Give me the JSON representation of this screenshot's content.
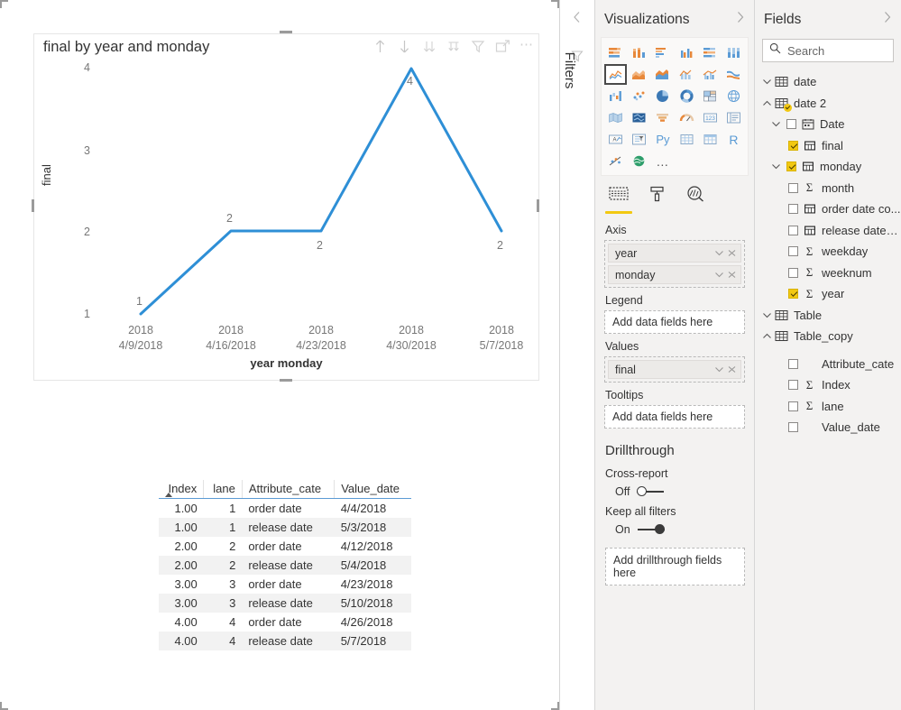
{
  "chart_data": {
    "type": "line",
    "title": "final by year and monday",
    "xlabel": "year monday",
    "ylabel": "final",
    "categories": [
      "2018\n4/9/2018",
      "2018\n4/16/2018",
      "2018\n4/23/2018",
      "2018\n4/30/2018",
      "2018\n5/7/2018"
    ],
    "category_lines": [
      [
        "2018",
        "4/9/2018"
      ],
      [
        "2018",
        "4/16/2018"
      ],
      [
        "2018",
        "4/23/2018"
      ],
      [
        "2018",
        "4/30/2018"
      ],
      [
        "2018",
        "5/7/2018"
      ]
    ],
    "values": [
      1,
      2,
      2,
      4,
      2
    ],
    "data_labels": [
      "1",
      "2",
      "2",
      "4",
      "2"
    ],
    "yticks": [
      "1",
      "2",
      "3",
      "4"
    ],
    "ylim": [
      1,
      4
    ],
    "grid": false,
    "legend": null,
    "series_color": "#2E8FD6",
    "line_width": 3
  },
  "visual": {
    "title": "final by year and monday",
    "toolbar": [
      {
        "name": "drill-up-icon",
        "label": "Drill up"
      },
      {
        "name": "drill-down-icon",
        "label": "Drill down"
      },
      {
        "name": "expand-all-icon",
        "label": "Expand all down one level"
      },
      {
        "name": "go-to-next-level-icon",
        "label": "Go to the next level"
      },
      {
        "name": "filter-icon",
        "label": "Filters"
      },
      {
        "name": "focus-mode-icon",
        "label": "Focus mode"
      },
      {
        "name": "more-options-icon",
        "label": "More options"
      }
    ]
  },
  "table_visual": {
    "columns": [
      "Index",
      "lane",
      "Attribute_cate",
      "Value_date"
    ],
    "sort_column": "Index",
    "sort_direction": "ascending",
    "rows": [
      {
        "Index": "1.00",
        "lane": "1",
        "Attribute_cate": "order date",
        "Value_date": "4/4/2018"
      },
      {
        "Index": "1.00",
        "lane": "1",
        "Attribute_cate": "release date",
        "Value_date": "5/3/2018"
      },
      {
        "Index": "2.00",
        "lane": "2",
        "Attribute_cate": "order date",
        "Value_date": "4/12/2018"
      },
      {
        "Index": "2.00",
        "lane": "2",
        "Attribute_cate": "release date",
        "Value_date": "5/4/2018"
      },
      {
        "Index": "3.00",
        "lane": "3",
        "Attribute_cate": "order date",
        "Value_date": "4/23/2018"
      },
      {
        "Index": "3.00",
        "lane": "3",
        "Attribute_cate": "release date",
        "Value_date": "5/10/2018"
      },
      {
        "Index": "4.00",
        "lane": "4",
        "Attribute_cate": "order date",
        "Value_date": "4/26/2018"
      },
      {
        "Index": "4.00",
        "lane": "4",
        "Attribute_cate": "release date",
        "Value_date": "5/7/2018"
      }
    ]
  },
  "filters_rail": {
    "label": "Filters"
  },
  "visualizations": {
    "title": "Visualizations",
    "gallery": [
      {
        "name": "stacked-bar-chart-icon",
        "selected": false
      },
      {
        "name": "stacked-column-chart-icon",
        "selected": false
      },
      {
        "name": "clustered-bar-chart-icon",
        "selected": false
      },
      {
        "name": "clustered-column-chart-icon",
        "selected": false
      },
      {
        "name": "hundred-percent-stacked-bar-chart-icon",
        "selected": false
      },
      {
        "name": "hundred-percent-stacked-column-chart-icon",
        "selected": false
      },
      {
        "name": "line-chart-icon",
        "selected": true
      },
      {
        "name": "area-chart-icon",
        "selected": false
      },
      {
        "name": "stacked-area-chart-icon",
        "selected": false
      },
      {
        "name": "line-and-stacked-column-chart-icon",
        "selected": false
      },
      {
        "name": "line-and-clustered-column-chart-icon",
        "selected": false
      },
      {
        "name": "ribbon-chart-icon",
        "selected": false
      },
      {
        "name": "waterfall-chart-icon",
        "selected": false
      },
      {
        "name": "scatter-chart-icon",
        "selected": false
      },
      {
        "name": "pie-chart-icon",
        "selected": false
      },
      {
        "name": "donut-chart-icon",
        "selected": false
      },
      {
        "name": "treemap-icon",
        "selected": false
      },
      {
        "name": "map-icon",
        "selected": false
      },
      {
        "name": "filled-map-icon",
        "selected": false
      },
      {
        "name": "shape-map-icon",
        "selected": false
      },
      {
        "name": "funnel-chart-icon",
        "selected": false
      },
      {
        "name": "gauge-icon",
        "selected": false
      },
      {
        "name": "card-icon",
        "selected": false
      },
      {
        "name": "multi-row-card-icon",
        "selected": false
      },
      {
        "name": "kpi-icon",
        "selected": false
      },
      {
        "name": "slicer-icon",
        "selected": false
      },
      {
        "name": "python-visual-icon",
        "selected": false,
        "text": "Py"
      },
      {
        "name": "table-icon",
        "selected": false
      },
      {
        "name": "matrix-icon",
        "selected": false
      },
      {
        "name": "r-script-visual-icon",
        "selected": false,
        "text": "R"
      },
      {
        "name": "key-influencers-icon",
        "selected": false
      },
      {
        "name": "arcgis-map-icon",
        "selected": false
      },
      {
        "name": "get-more-visuals-icon",
        "selected": false,
        "text": "…"
      }
    ],
    "tabs": [
      {
        "name": "tab-fields",
        "icon": "fields-icon",
        "active": true
      },
      {
        "name": "tab-format",
        "icon": "paint-roller-icon",
        "active": false
      },
      {
        "name": "tab-analytics",
        "icon": "analytics-magnifier-icon",
        "active": false
      }
    ],
    "wells": [
      {
        "label": "Axis",
        "empty_text": null,
        "fields": [
          "year",
          "monday"
        ]
      },
      {
        "label": "Legend",
        "empty_text": "Add data fields here",
        "fields": []
      },
      {
        "label": "Values",
        "empty_text": null,
        "fields": [
          "final"
        ]
      },
      {
        "label": "Tooltips",
        "empty_text": "Add data fields here",
        "fields": []
      }
    ],
    "drillthrough": {
      "title": "Drillthrough",
      "cross_report": {
        "label": "Cross-report",
        "state": "Off",
        "on": false
      },
      "keep_all_filters": {
        "label": "Keep all filters",
        "state": "On",
        "on": true
      },
      "drop_text": "Add drillthrough fields here"
    }
  },
  "fields": {
    "title": "Fields",
    "search_placeholder": "Search",
    "search_value": "",
    "tree": [
      {
        "label": "date",
        "kind": "table",
        "expanded": false,
        "indent": 0,
        "chevron": "down",
        "checked": false,
        "badge": false
      },
      {
        "label": "date 2",
        "kind": "table",
        "expanded": true,
        "indent": 0,
        "chevron": "up",
        "checked": false,
        "badge": true
      },
      {
        "label": "Date",
        "kind": "date-hierarchy",
        "expanded": true,
        "indent": 1,
        "chevron": "down",
        "checked": false,
        "badge": false
      },
      {
        "label": "final",
        "kind": "calendar-field",
        "expanded": false,
        "indent": 2,
        "chevron": "none",
        "checked": true,
        "badge": false
      },
      {
        "label": "monday",
        "kind": "calendar-field",
        "expanded": true,
        "indent": 1,
        "chevron": "down",
        "checked": true,
        "badge": false
      },
      {
        "label": "month",
        "kind": "measure",
        "expanded": false,
        "indent": 2,
        "chevron": "none",
        "checked": false,
        "badge": false
      },
      {
        "label": "order date co...",
        "kind": "calendar-field",
        "expanded": false,
        "indent": 2,
        "chevron": "none",
        "checked": false,
        "badge": false
      },
      {
        "label": "release date c...",
        "kind": "calendar-field",
        "expanded": false,
        "indent": 2,
        "chevron": "none",
        "checked": false,
        "badge": false
      },
      {
        "label": "weekday",
        "kind": "measure",
        "expanded": false,
        "indent": 2,
        "chevron": "none",
        "checked": false,
        "badge": false
      },
      {
        "label": "weeknum",
        "kind": "measure",
        "expanded": false,
        "indent": 2,
        "chevron": "none",
        "checked": false,
        "badge": false
      },
      {
        "label": "year",
        "kind": "measure",
        "expanded": false,
        "indent": 2,
        "chevron": "none",
        "checked": true,
        "badge": false
      },
      {
        "label": "Table",
        "kind": "table",
        "expanded": false,
        "indent": 0,
        "chevron": "down",
        "checked": false,
        "badge": false
      },
      {
        "label": "Table_copy",
        "kind": "table",
        "expanded": true,
        "indent": 0,
        "chevron": "up",
        "checked": false,
        "badge": false
      },
      {
        "label": "Attribute_cate",
        "kind": "text",
        "expanded": false,
        "indent": 2,
        "chevron": "none",
        "checked": false,
        "badge": false
      },
      {
        "label": "Index",
        "kind": "measure",
        "expanded": false,
        "indent": 2,
        "chevron": "none",
        "checked": false,
        "badge": false
      },
      {
        "label": "lane",
        "kind": "measure",
        "expanded": false,
        "indent": 2,
        "chevron": "none",
        "checked": false,
        "badge": false
      },
      {
        "label": "Value_date",
        "kind": "text",
        "expanded": false,
        "indent": 2,
        "chevron": "none",
        "checked": false,
        "badge": false
      }
    ]
  },
  "colors": {
    "accent_blue": "#2E8FD6",
    "highlight_yellow": "#F2C811",
    "panel_bg": "#F3F2F1",
    "table_header_rule": "#5B9BD5"
  }
}
